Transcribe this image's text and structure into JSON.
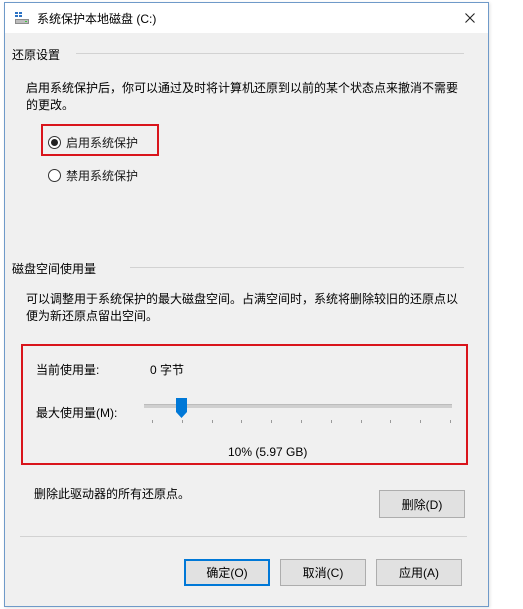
{
  "window": {
    "title": "系统保护本地磁盘 (C:)",
    "icon": "drive-icon",
    "close_label": "×"
  },
  "restore_settings": {
    "heading": "还原设置",
    "description": "启用系统保护后，你可以通过及时将计算机还原到以前的某个状态点来撤消不需要的更改。",
    "options": [
      {
        "label": "启用系统保护",
        "selected": true
      },
      {
        "label": "禁用系统保护",
        "selected": false
      }
    ]
  },
  "disk_usage": {
    "heading": "磁盘空间使用量",
    "description": "可以调整用于系统保护的最大磁盘空间。占满空间时，系统将删除较旧的还原点以便为新还原点留出空间。",
    "current_usage_label": "当前使用量:",
    "current_usage_value": "0 字节",
    "max_usage_label": "最大使用量(M):",
    "max_usage_fraction": 0.1,
    "max_usage_readout": "10% (5.97 GB)",
    "delete_text": "删除此驱动器的所有还原点。",
    "delete_button": "删除(D)"
  },
  "footer": {
    "ok": "确定(O)",
    "cancel": "取消(C)",
    "apply": "应用(A)"
  },
  "colors": {
    "highlight_red": "#d9141b",
    "accent_blue": "#0078d7"
  }
}
